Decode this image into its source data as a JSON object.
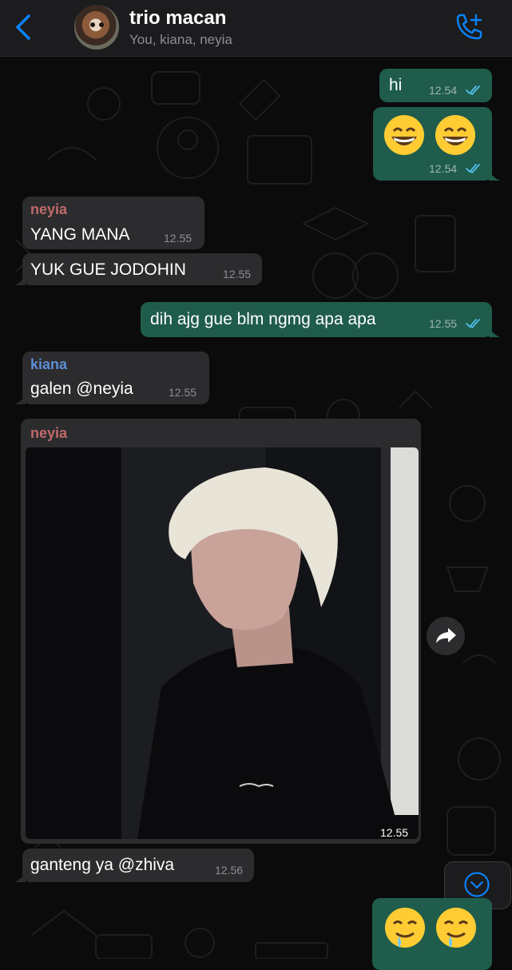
{
  "header": {
    "back_icon": "chevron-left-icon",
    "title": "trio macan",
    "subtitle": "You, kiana, neyia",
    "call_icon": "add-call-icon",
    "accent": "#0a84ff"
  },
  "colors": {
    "outgoing_bubble": "#1f5c4b",
    "incoming_bubble": "#2c2c2e",
    "sender_neyia": "#c06a6a",
    "sender_kiana": "#5e8fd6",
    "read_ticks": "#53bdeb"
  },
  "messages": [
    {
      "direction": "out",
      "text": "hi",
      "time": "12.54",
      "status": "read"
    },
    {
      "direction": "out",
      "emoji": [
        "grinning-face-with-smiling-eyes",
        "grinning-face-with-smiling-eyes"
      ],
      "time": "12.54",
      "status": "read"
    },
    {
      "direction": "in",
      "sender": "neyia",
      "text": "YANG MANA",
      "time": "12.55"
    },
    {
      "direction": "in",
      "text": "YUK GUE JODOHIN",
      "time": "12.55"
    },
    {
      "direction": "out",
      "text": "dih ajg gue blm ngmg apa apa",
      "time": "12.55",
      "status": "read"
    },
    {
      "direction": "in",
      "sender": "kiana",
      "text": "galen @neyia",
      "time": "12.55"
    },
    {
      "direction": "in",
      "sender": "neyia",
      "photo": "photo-of-person-profile",
      "time": "12.55"
    },
    {
      "direction": "in",
      "text": "ganteng ya @zhiva",
      "time": "12.56"
    },
    {
      "direction": "out",
      "emoji": [
        "drooling-face",
        "drooling-face"
      ]
    }
  ],
  "controls": {
    "forward_icon": "forward-share-icon",
    "scroll_down_icon": "chevron-down-circle-icon"
  }
}
